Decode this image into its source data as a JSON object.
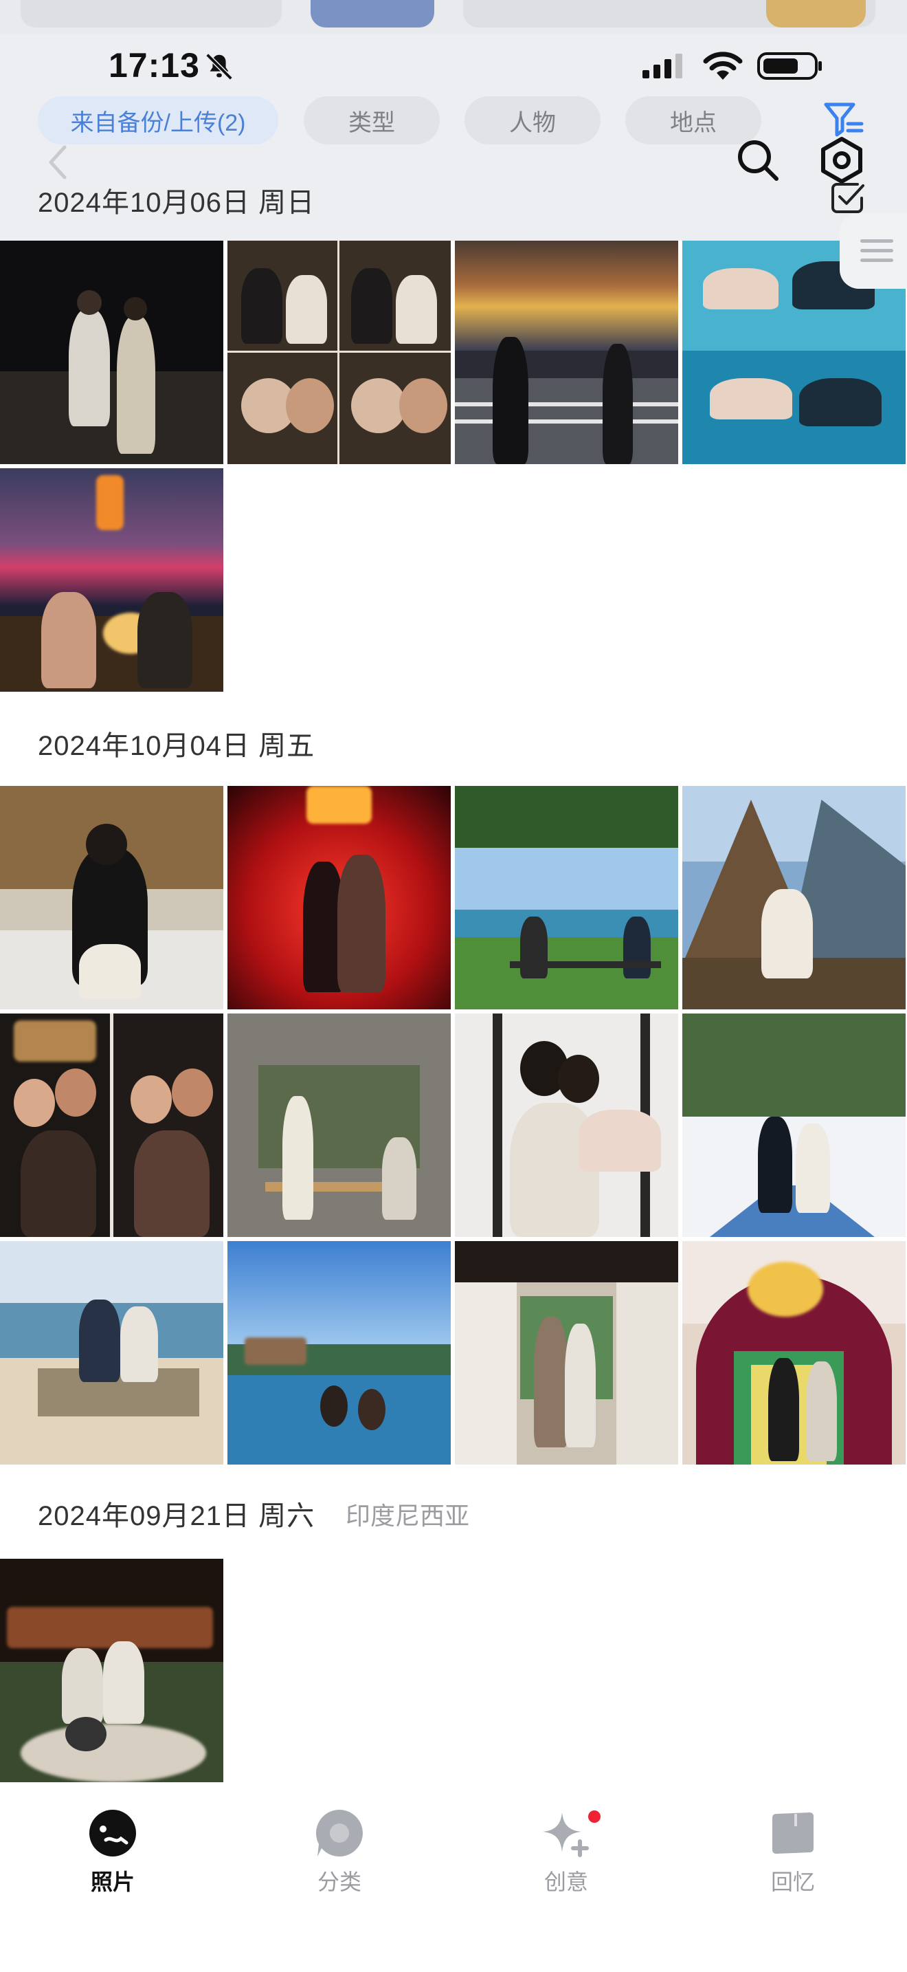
{
  "status_bar": {
    "time": "17:13",
    "icons": [
      "mute-bell-icon",
      "cellular-signal-icon",
      "wifi-icon",
      "battery-icon"
    ]
  },
  "filter_chips": [
    {
      "label": "来自备份/上传(2)",
      "active": true
    },
    {
      "label": "类型",
      "active": false
    },
    {
      "label": "人物",
      "active": false
    },
    {
      "label": "地点",
      "active": false
    }
  ],
  "header_actions": [
    "filter-icon",
    "back-icon",
    "search-icon",
    "settings-icon",
    "select-check-icon"
  ],
  "sections": [
    {
      "date": "2024年10月06日 周日",
      "location": "",
      "photo_count": 5
    },
    {
      "date": "2024年10月04日 周五",
      "location": "",
      "photo_count": 12
    },
    {
      "date": "2024年09月21日 周六",
      "location": "印度尼西亚",
      "photo_count": 1
    }
  ],
  "bottom_nav": [
    {
      "label": "照片",
      "icon": "photos-icon",
      "active": true
    },
    {
      "label": "分类",
      "icon": "category-icon",
      "active": false
    },
    {
      "label": "创意",
      "icon": "sparkle-icon",
      "active": false,
      "badge": true
    },
    {
      "label": "回忆",
      "icon": "memories-icon",
      "active": false
    }
  ],
  "colors": {
    "accent": "#4a80d6",
    "badge": "#ee2233",
    "header_bg": "#ecedf0",
    "chip_bg": "#e1e3e7"
  }
}
